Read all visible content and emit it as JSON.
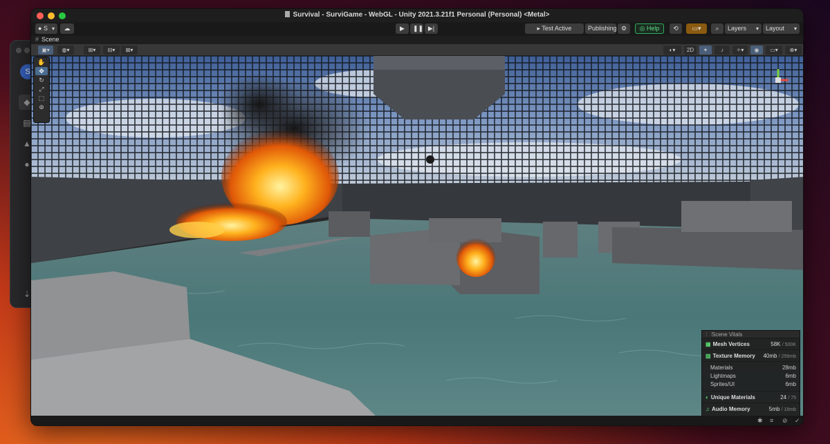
{
  "window": {
    "title": "Survival - SurviGame - WebGL - Unity 2021.3.21f1 Personal (Personal) <Metal>"
  },
  "hub": {
    "avatar_letter": "S"
  },
  "toolbar": {
    "account_label": "S",
    "test_active_scene": "Test Active Scene",
    "publishing": "Publishing",
    "help": "Help",
    "layers": "Layers",
    "layout": "Layout"
  },
  "scene_tab": {
    "label": "Scene"
  },
  "scene_tools": {
    "mode_2d": "2D"
  },
  "vitals": {
    "header": "Scene Vitals",
    "mesh_vertices": {
      "label": "Mesh Vertices",
      "value": "58K",
      "limit": "/ 500K"
    },
    "texture_memory": {
      "label": "Texture Memory",
      "value": "40mb",
      "limit": "/ 256mb"
    },
    "breakdown": [
      {
        "label": "Materials",
        "value": "28mb"
      },
      {
        "label": "Lightmaps",
        "value": "6mb"
      },
      {
        "label": "Sprites/UI",
        "value": "6mb"
      }
    ],
    "unique_materials": {
      "label": "Unique Materials",
      "value": "24",
      "limit": "/ 75"
    },
    "audio_memory": {
      "label": "Audio Memory",
      "value": "5mb",
      "limit": "/ 16mb"
    }
  },
  "colors": {
    "accent": "#4a6c90",
    "help_green": "#2fb060",
    "vitals_icon": "#58d06f",
    "close": "#ff5f57",
    "minimize": "#febc2e",
    "zoom": "#28c840"
  }
}
